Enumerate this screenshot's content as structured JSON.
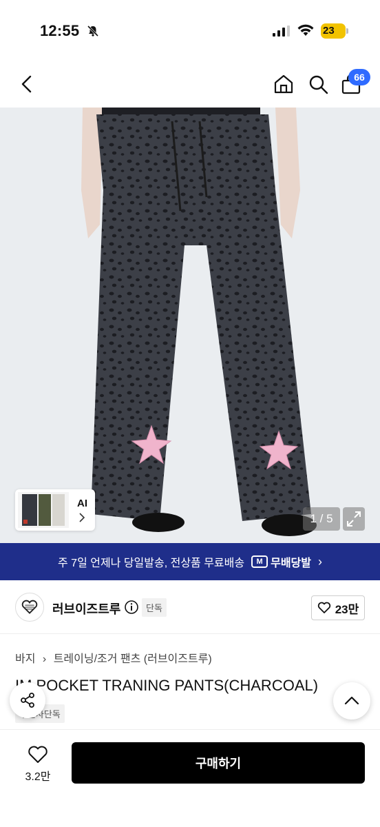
{
  "status": {
    "time": "12:55",
    "battery": "23"
  },
  "header": {
    "cart_count": "66"
  },
  "gallery": {
    "ai_label": "AI",
    "pager": "1 / 5"
  },
  "banner": {
    "text": "주 7일 언제나 당일발송, 전상품 무료배송",
    "logo_mark": "M",
    "logo_text": "무배당발",
    "chevron": "›"
  },
  "brand": {
    "name": "러브이즈트루",
    "exclusive_label": "단독",
    "likes": "23만"
  },
  "breadcrumb": {
    "category": "바지",
    "separator": "›",
    "subcategory": "트레이닝/조거 팬츠 (러브이즈트루)"
  },
  "product": {
    "title": "IM POCKET TRANING PANTS(CHARCOAL)",
    "sub_badge": "무신사단독"
  },
  "bottom": {
    "wish_count": "3.2만",
    "buy_label": "구매하기"
  },
  "colors": {
    "banner": "#1f2e8a",
    "badge": "#2f6bff",
    "buy": "#000000",
    "battery": "#f2c300"
  }
}
